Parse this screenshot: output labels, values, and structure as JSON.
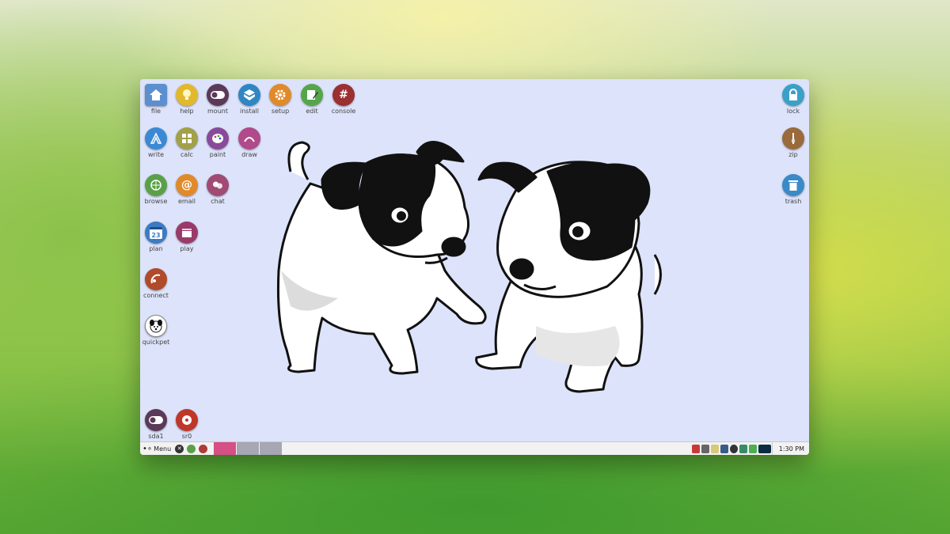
{
  "desktop_icons": {
    "file": "file",
    "help": "help",
    "mount": "mount",
    "install": "install",
    "setup": "setup",
    "edit": "edit",
    "console": "console",
    "write": "write",
    "calc": "calc",
    "paint": "paint",
    "draw": "draw",
    "browse": "browse",
    "email": "email",
    "chat": "chat",
    "plan": "plan",
    "play": "play",
    "connect": "connect",
    "quickpet": "quickpet",
    "sda1": "sda1",
    "sr0": "sr0",
    "lock": "lock",
    "zip": "zip",
    "trash": "trash"
  },
  "icon_glyphs": {
    "console": "#",
    "email": "@",
    "plan_day": "23"
  },
  "icon_colors": {
    "file": "#5b8fd0",
    "help": "#e2b82d",
    "mount": "#5a3a58",
    "install": "#2f86c3",
    "setup": "#e08a2a",
    "edit": "#55a64a",
    "console": "#9b2f32",
    "write": "#3b89d4",
    "calc": "#a3a04a",
    "paint": "#8a4a9a",
    "draw": "#b04a8a",
    "browse": "#5aa048",
    "email": "#e08a2a",
    "chat": "#a04a74",
    "plan": "#3b7bc4",
    "play": "#9a3a6a",
    "connect": "#b04a2a",
    "quickpet": "#ffffff",
    "sda1": "#5a3a58",
    "sr0": "#c0362a",
    "lock": "#3aa0c8",
    "zip": "#9a6a3a",
    "trash": "#3a8ac8"
  },
  "taskbar": {
    "menu_label": "Menu",
    "clock": "1:30 PM",
    "workspace_colors": [
      "#d64f86",
      "#a6a6b4",
      "#a6a6b4"
    ]
  }
}
